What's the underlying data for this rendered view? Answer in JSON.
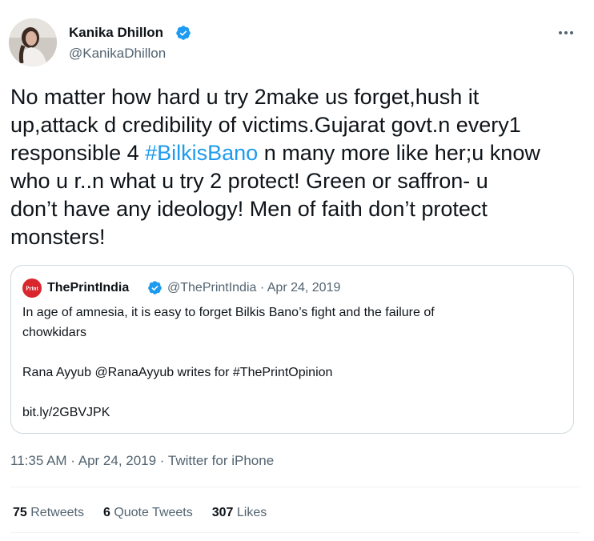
{
  "author": {
    "name": "Kanika Dhillon",
    "handle": "@KanikaDhillon"
  },
  "tweet": {
    "lines": [
      "No matter how hard u try 2make us forget,hush it",
      "up,attack d credibility of victims.Gujarat govt.n every1",
      "responsible 4 ",
      "#BilkisBano",
      " n many more like her;u know",
      "who u r..n what u try 2 protect! Green or saffron- u",
      "don’t have any ideology! Men of faith don’t protect",
      "monsters!"
    ]
  },
  "quote": {
    "avatar_text": "Print",
    "name": "ThePrintIndia",
    "meta": "@ThePrintIndia · Apr 24, 2019",
    "line1": "In age of amnesia, it is easy to forget Bilkis Bano’s fight and the failure of",
    "line2": "chowkidars",
    "line3": "Rana Ayyub @RanaAyyub writes for #ThePrintOpinion",
    "line4": "bit.ly/2GBVJPK"
  },
  "timestamp": "11:35 AM · Apr 24, 2019 · Twitter for iPhone",
  "stats": {
    "retweets_count": "75",
    "retweets_label": "Retweets",
    "quotes_count": "6",
    "quotes_label": "Quote Tweets",
    "likes_count": "307",
    "likes_label": "Likes"
  },
  "colors": {
    "accent": "#1d9bf0",
    "secondary_text": "#536471",
    "border": "#cfd9de",
    "print_red": "#d9272e"
  },
  "icons": [
    "verified-badge-icon",
    "more-options-icon"
  ]
}
